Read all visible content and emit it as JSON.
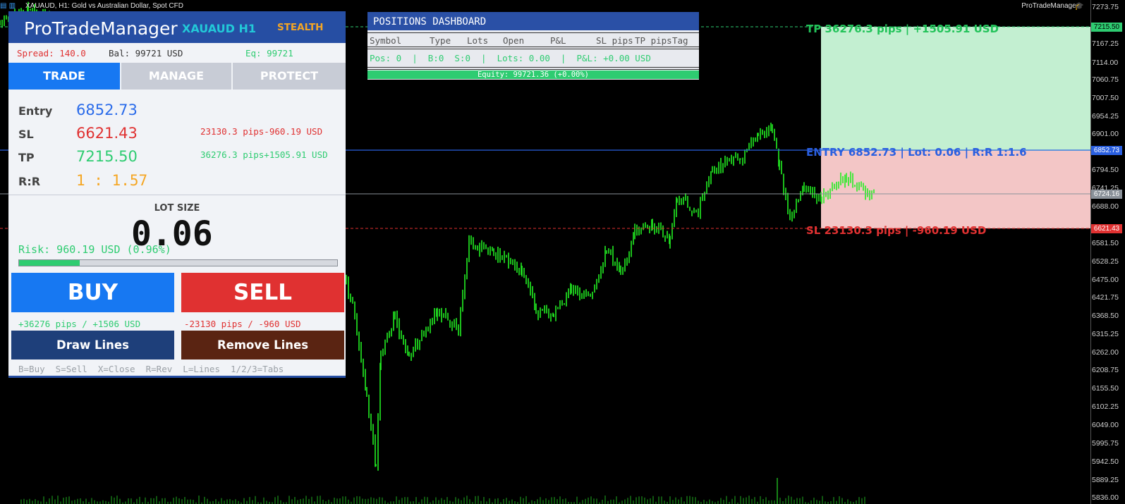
{
  "window": {
    "title": "XAUAUD, H1:  Gold vs Australian Dollar, Spot CFD",
    "ea_name": "ProTradeManager"
  },
  "price_axis": {
    "ticks": [
      "7273.75",
      "7167.25",
      "7114.00",
      "7060.75",
      "7007.50",
      "6954.25",
      "6901.00",
      "6794.50",
      "6741.25",
      "6688.00",
      "6621.43",
      "6581.50",
      "6528.25",
      "6475.00",
      "6421.75",
      "6368.50",
      "6315.25",
      "6262.00",
      "6208.75",
      "6155.50",
      "6102.25",
      "6049.00",
      "5995.75",
      "5942.50",
      "5889.25",
      "5836.00"
    ],
    "tp_tag": "7215.50",
    "entry_tag": "6852.73",
    "current_tag": "6724.16",
    "sl_tag": "6621.43"
  },
  "chart_labels": {
    "tp": "TP  36276.3 pips  |  +1505.91 USD",
    "entry": "ENTRY 6852.73  |  Lot: 0.06  |  R:R 1:1.6",
    "sl": "SL  23130.3 pips  |  -960.19 USD"
  },
  "panel": {
    "brand": "ProTradeManager",
    "symbol": "XAUAUD  H1",
    "mode": "STEALTH",
    "spread": "Spread: 140.0",
    "balance": "Bal: 99721 USD",
    "equity": "Eq: 99721",
    "tabs": [
      "TRADE",
      "MANAGE",
      "PROTECT"
    ],
    "entry_label": "Entry",
    "entry_value": "6852.73",
    "sl_label": "SL",
    "sl_value": "6621.43",
    "sl_info": "23130.3 pips-960.19 USD",
    "tp_label": "TP",
    "tp_value": "7215.50",
    "tp_info": "36276.3 pips+1505.91 USD",
    "rr_label": "R:R",
    "rr_value": "1 : 1.57",
    "lot_title": "LOT SIZE",
    "lot_value": "0.06",
    "risk": "Risk: 960.19 USD  (0.96%)",
    "risk_bar_fraction": 0.19,
    "buy_label": "BUY",
    "sell_label": "SELL",
    "buy_info": "+36276 pips / +1506 USD",
    "sell_info": "-23130 pips / -960 USD",
    "draw_lines": "Draw Lines",
    "remove_lines": "Remove Lines",
    "hints": "B=Buy  S=Sell  X=Close  R=Rev  L=Lines  1/2/3=Tabs"
  },
  "dashboard": {
    "title": "POSITIONS DASHBOARD",
    "columns": [
      "Symbol",
      "Type",
      "Lots",
      "Open",
      "P&L",
      "SL pips",
      "TP pips",
      "Tag"
    ],
    "summary": "Pos: 0  |  B:0  S:0  |  Lots: 0.00  |  P&L: +0.00 USD",
    "equity": "Equity: 99721.36 (+0.00%)"
  },
  "colors": {
    "buy": "#1778f2",
    "sell": "#e03131",
    "tp_zone": "#c3efd1",
    "sl_zone": "#f3c6c6",
    "candles": "#22ee22",
    "header": "#264ea3"
  }
}
